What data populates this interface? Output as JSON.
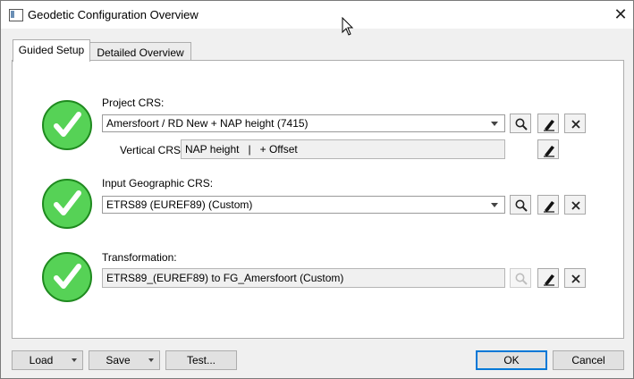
{
  "window": {
    "title": "Geodetic Configuration Overview",
    "close_icon": "close-icon"
  },
  "tabs": [
    {
      "label": "Guided Setup",
      "active": true
    },
    {
      "label": "Detailed Overview",
      "active": false
    }
  ],
  "project_crs": {
    "label": "Project CRS:",
    "value": "Amersfoort / RD New + NAP height (7415)",
    "status": "valid"
  },
  "vertical_crs": {
    "label": "Vertical CRS:",
    "value": "NAP height   |   + Offset"
  },
  "input_crs": {
    "label": "Input Geographic CRS:",
    "value": "ETRS89 (EUREF89) (Custom)",
    "status": "valid"
  },
  "transformation": {
    "label": "Transformation:",
    "value": "ETRS89_(EUREF89) to FG_Amersfoort (Custom)",
    "status": "valid"
  },
  "footer": {
    "load": "Load",
    "save": "Save",
    "test": "Test...",
    "ok": "OK",
    "cancel": "Cancel"
  },
  "colors": {
    "check_fill": "#56d256",
    "check_border": "#1f8a1f",
    "default_button_border": "#0078d7"
  }
}
